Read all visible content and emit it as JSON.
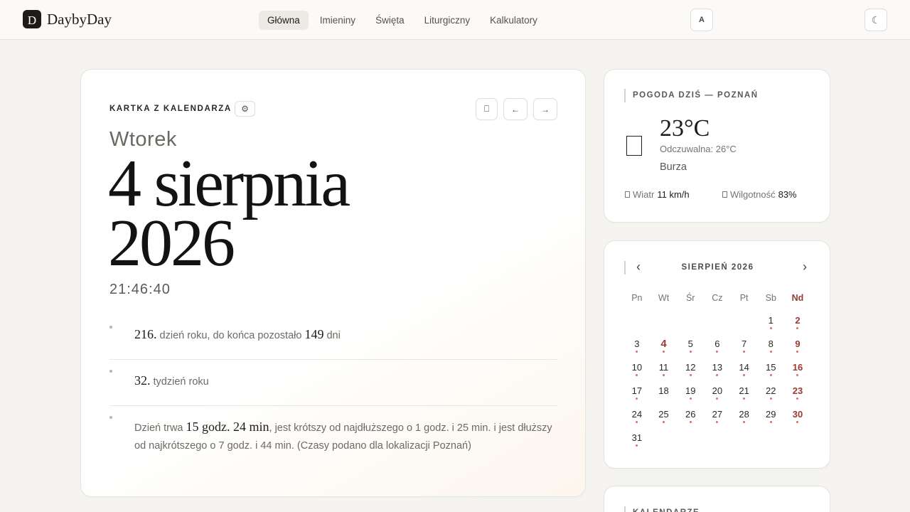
{
  "brand": {
    "logo_letter": "D",
    "name": "DaybyDay"
  },
  "nav": [
    {
      "label": "Główna",
      "active": true
    },
    {
      "label": "Imieniny",
      "active": false
    },
    {
      "label": "Święta",
      "active": false
    },
    {
      "label": "Liturgiczny",
      "active": false
    },
    {
      "label": "Kalkulatory",
      "active": false
    }
  ],
  "header": {
    "font_button": "A",
    "theme_button": "☾"
  },
  "main_card": {
    "label": "KARTKA Z KALENDARZA",
    "settings_icon": "⚙",
    "share_icon": "⎕",
    "prev_icon": "←",
    "next_icon": "→",
    "weekday": "Wtorek",
    "date_line1": "4 sierpnia",
    "date_line2": "2026",
    "time": "21:46:40",
    "facts": {
      "day_num": "216.",
      "day_text1": " dzień roku, do końca pozostało ",
      "days_left": "149",
      "day_text2": " dni",
      "week_num": "32.",
      "week_text": " tydzień roku",
      "len_text1": "Dzień trwa ",
      "len_value": "15 godz. 24 min",
      "len_text2": ", jest krótszy od najdłuższego o 1 godz. i 25 min. i jest dłuższy od najkrótszego o 7 godz. i 44 min. (Czasy podano dla lokalizacji Poznań)"
    }
  },
  "weather": {
    "label": "POGODA DZIŚ — POZNAŃ",
    "icon": "storm-icon",
    "temp": "23°C",
    "feels_like": "Odczuwalna: 26°C",
    "description": "Burza",
    "wind_label": "Wiatr",
    "wind_value": "11 km/h",
    "humidity_label": "Wilgotność",
    "humidity_value": "83%"
  },
  "calendar": {
    "month": "SIERPIEŃ 2026",
    "prev": "‹",
    "next": "›",
    "weekdays": [
      "Pn",
      "Wt",
      "Śr",
      "Cz",
      "Pt",
      "Sb",
      "Nd"
    ],
    "weeks": [
      [
        "",
        "",
        "",
        "",
        "",
        "1",
        "2"
      ],
      [
        "3",
        "4",
        "5",
        "6",
        "7",
        "8",
        "9"
      ],
      [
        "10",
        "11",
        "12",
        "13",
        "14",
        "15",
        "16"
      ],
      [
        "17",
        "18",
        "19",
        "20",
        "21",
        "22",
        "23"
      ],
      [
        "24",
        "25",
        "26",
        "27",
        "28",
        "29",
        "30"
      ],
      [
        "31",
        "",
        "",
        "",
        "",
        "",
        ""
      ]
    ],
    "today": "4",
    "no_event_days": [
      "18"
    ]
  },
  "bottom_card": {
    "label": "KALENDARZE"
  },
  "colors": {
    "accent_red": "#9c3a32",
    "event_dot": "#d97060",
    "dark": "#1d1c1a"
  }
}
